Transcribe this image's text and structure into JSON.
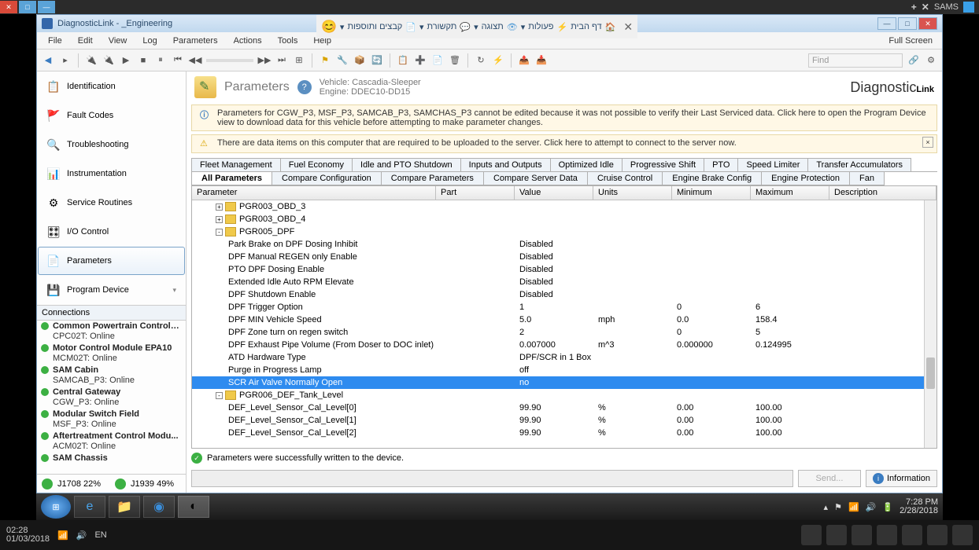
{
  "os_top": {
    "sams": "SAMS"
  },
  "hebrew_tabs": [
    "דף הבית",
    "פעולות",
    "תצוגה",
    "תקשורת",
    "קבצים ותוספות"
  ],
  "app": {
    "title": "DiagnosticLink - _Engineering",
    "menus": [
      "File",
      "Edit",
      "View",
      "Log",
      "Parameters",
      "Actions",
      "Tools",
      "Help"
    ],
    "fullscreen": "Full Screen",
    "find": "Find"
  },
  "nav": [
    {
      "label": "Identification",
      "icon": "📋"
    },
    {
      "label": "Fault Codes",
      "icon": "🚩"
    },
    {
      "label": "Troubleshooting",
      "icon": "🔍"
    },
    {
      "label": "Instrumentation",
      "icon": "📊"
    },
    {
      "label": "Service Routines",
      "icon": "⚙"
    },
    {
      "label": "I/O Control",
      "icon": "🎛"
    },
    {
      "label": "Parameters",
      "icon": "📄",
      "selected": true
    },
    {
      "label": "Program Device",
      "icon": "💾",
      "chev": true
    }
  ],
  "connections_header": "Connections",
  "connections": [
    {
      "name": "Common Powertrain Controlle...",
      "status": "CPC02T: Online"
    },
    {
      "name": "Motor Control Module EPA10",
      "status": "MCM02T: Online"
    },
    {
      "name": "SAM Cabin",
      "status": "SAMCAB_P3: Online"
    },
    {
      "name": "Central Gateway",
      "status": "CGW_P3: Online"
    },
    {
      "name": "Modular Switch Field",
      "status": "MSF_P3: Online"
    },
    {
      "name": "Aftertreatment Control Modu...",
      "status": "ACM02T: Online"
    },
    {
      "name": "SAM Chassis",
      "status": ""
    }
  ],
  "bus": {
    "j1708": "J1708 22%",
    "j1939": "J1939 49%"
  },
  "header": {
    "title": "Parameters",
    "vehicle": "Vehicle: Cascadia-Sleeper",
    "engine": "Engine: DDEC10-DD15",
    "logo": "DiagnosticLink"
  },
  "msg1": "Parameters for CGW_P3, MSF_P3, SAMCAB_P3, SAMCHAS_P3 cannot be edited because it was not possible to verify their Last Serviced data. Click here to open the Program Device view to download data for this vehicle before attempting to make parameter changes.",
  "msg2": "There are data items on this computer that are required to be uploaded to the server. Click here to attempt to connect to the server now.",
  "tabs_top": [
    "Fleet Management",
    "Fuel Economy",
    "Idle and PTO Shutdown",
    "Inputs and Outputs",
    "Optimized Idle",
    "Progressive Shift",
    "PTO",
    "Speed Limiter",
    "Transfer Accumulators"
  ],
  "tabs_bottom": [
    "All Parameters",
    "Compare Configuration",
    "Compare Parameters",
    "Compare Server Data",
    "Cruise Control",
    "Engine Brake Config",
    "Engine Protection",
    "Fan"
  ],
  "columns": [
    "Parameter",
    "Part",
    "Value",
    "Units",
    "Minimum",
    "Maximum",
    "Description"
  ],
  "rows": [
    {
      "type": "group",
      "exp": "+",
      "name": "PGR003_OBD_3"
    },
    {
      "type": "group",
      "exp": "+",
      "name": "PGR003_OBD_4"
    },
    {
      "type": "group",
      "exp": "-",
      "name": "PGR005_DPF"
    },
    {
      "type": "child",
      "name": "Park Brake on DPF Dosing Inhibit",
      "value": "Disabled"
    },
    {
      "type": "child",
      "name": "DPF Manual REGEN only Enable",
      "value": "Disabled"
    },
    {
      "type": "child",
      "name": "PTO DPF Dosing Enable",
      "value": "Disabled"
    },
    {
      "type": "child",
      "name": "Extended Idle Auto RPM Elevate",
      "value": "Disabled"
    },
    {
      "type": "child",
      "name": "DPF Shutdown Enable",
      "value": "Disabled"
    },
    {
      "type": "child",
      "name": "DPF Trigger Option",
      "value": "1",
      "min": "0",
      "max": "6"
    },
    {
      "type": "child",
      "name": "DPF MIN Vehicle Speed",
      "value": "5.0",
      "units": "mph",
      "min": "0.0",
      "max": "158.4"
    },
    {
      "type": "child",
      "name": "DPF Zone turn on regen switch",
      "value": "2",
      "min": "0",
      "max": "5"
    },
    {
      "type": "child",
      "name": "DPF Exhaust Pipe Volume (From Doser to DOC inlet)",
      "value": "0.007000",
      "units": "m^3",
      "min": "0.000000",
      "max": "0.124995"
    },
    {
      "type": "child",
      "name": "ATD Hardware Type",
      "value": "DPF/SCR in 1 Box"
    },
    {
      "type": "child",
      "name": "Purge in Progress Lamp",
      "value": "off"
    },
    {
      "type": "child",
      "name": "SCR Air Valve Normally Open",
      "value": "no",
      "selected": true
    },
    {
      "type": "group",
      "exp": "-",
      "name": "PGR006_DEF_Tank_Level"
    },
    {
      "type": "child",
      "name": "DEF_Level_Sensor_Cal_Level[0]",
      "value": "99.90",
      "units": "%",
      "min": "0.00",
      "max": "100.00"
    },
    {
      "type": "child",
      "name": "DEF_Level_Sensor_Cal_Level[1]",
      "value": "99.90",
      "units": "%",
      "min": "0.00",
      "max": "100.00"
    },
    {
      "type": "child",
      "name": "DEF_Level_Sensor_Cal_Level[2]",
      "value": "99.90",
      "units": "%",
      "min": "0.00",
      "max": "100.00"
    }
  ],
  "status_msg": "Parameters were successfully written to the device.",
  "send": "Send...",
  "info_btn": "Information",
  "taskbar_time": "7:28 PM",
  "taskbar_date": "2/28/2018",
  "os_time": "02:28",
  "os_date": "01/03/2018",
  "os_lang": "EN"
}
